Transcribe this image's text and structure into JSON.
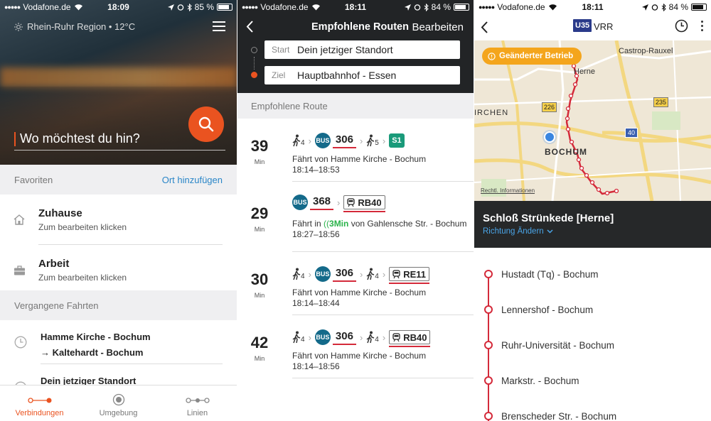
{
  "panel1": {
    "status": {
      "carrier": "Vodafone.de",
      "time": "18:09",
      "battery": "85 %",
      "battery_level": 0.85
    },
    "region": "Rhein-Ruhr Region • 12°C",
    "search_placeholder": "Wo möchtest du hin?",
    "favorites": {
      "header": "Favoriten",
      "add_link": "Ort hinzufügen",
      "items": [
        {
          "title": "Zuhause",
          "subtitle": "Zum bearbeiten klicken",
          "icon": "home-icon"
        },
        {
          "title": "Arbeit",
          "subtitle": "Zum bearbeiten klicken",
          "icon": "briefcase-icon"
        }
      ]
    },
    "past_trips": {
      "header": "Vergangene Fahrten",
      "items": [
        {
          "from": "Hamme Kirche - Bochum",
          "to": "→  Kaltehardt - Bochum"
        },
        {
          "from": "Dein jetziger Standort",
          "to": ""
        }
      ]
    },
    "tabs": [
      {
        "label": "Verbindungen",
        "icon": "connections-icon",
        "active": true
      },
      {
        "label": "Umgebung",
        "icon": "location-target-icon",
        "active": false
      },
      {
        "label": "Linien",
        "icon": "lines-icon",
        "active": false
      }
    ],
    "colors": {
      "accent": "#ea5320",
      "link": "#2a86c8"
    }
  },
  "panel2": {
    "status": {
      "carrier": "Vodafone.de",
      "time": "18:11",
      "battery": "84 %",
      "battery_level": 0.84
    },
    "title": "Empfohlene Routen",
    "edit": "Bearbeiten",
    "start_label": "Start",
    "start_value": "Dein jetziger Standort",
    "dest_label": "Ziel",
    "dest_value": "Hauptbahnhof - Essen",
    "section_header": "Empfohlene Route",
    "routes": [
      {
        "duration": "39",
        "unit": "Min",
        "legs": {
          "walk1": "4",
          "bus_label": "BUS",
          "bus_line": "306",
          "walk2": "5",
          "final": "S1"
        },
        "desc_pre": "Fährt von Hamme Kirche - Bochum",
        "realtime": "",
        "desc_post": "",
        "times": "18:14–18:53"
      },
      {
        "duration": "29",
        "unit": "Min",
        "legs": {
          "bus_label": "BUS",
          "bus_line": "368",
          "train": "RB40"
        },
        "desc_pre": "Fährt in ",
        "realtime": "3Min",
        "desc_post": " von Gahlensche Str. - Bochum",
        "times": "18:27–18:56"
      },
      {
        "duration": "30",
        "unit": "Min",
        "legs": {
          "walk1": "4",
          "bus_label": "BUS",
          "bus_line": "306",
          "walk2": "4",
          "train": "RE11"
        },
        "desc_pre": "Fährt von Hamme Kirche - Bochum",
        "realtime": "",
        "desc_post": "",
        "times": "18:14–18:44"
      },
      {
        "duration": "42",
        "unit": "Min",
        "legs": {
          "walk1": "4",
          "bus_label": "BUS",
          "bus_line": "306",
          "walk2": "4",
          "train": "RB40"
        },
        "desc_pre": "Fährt von Hamme Kirche - Bochum",
        "realtime": "",
        "desc_post": "",
        "times": "18:14–18:56"
      }
    ],
    "colors": {
      "bus": "#146a8a",
      "line_underline": "#d42a3a",
      "sbahn": "#1a9a7a",
      "realtime": "#2ab34a"
    }
  },
  "panel3": {
    "status": {
      "carrier": "Vodafone.de",
      "time": "18:11",
      "battery": "84 %",
      "battery_level": 0.84
    },
    "line_badge": "U35",
    "operator": "VRR",
    "map": {
      "notice": "Geänderter Betrieb",
      "labels": {
        "castrop": "Castrop-Rauxel",
        "herne": "Herne",
        "eichen": "IRCHEN",
        "bochum": "BOCHUM"
      },
      "road_shields": [
        "226",
        "235",
        "40"
      ],
      "legal": "Rechtl. Informationen"
    },
    "stop_name": "Schloß Strünkede [Herne]",
    "direction_link": "Richtung Ändern",
    "stops": [
      "Hustadt (Tq) - Bochum",
      "Lennershof - Bochum",
      "Ruhr-Universität - Bochum",
      "Markstr. - Bochum",
      "Brenscheder Str. - Bochum"
    ],
    "colors": {
      "line": "#d42a3a",
      "badge": "#2a3a8a",
      "notice": "#f4a51c"
    }
  }
}
